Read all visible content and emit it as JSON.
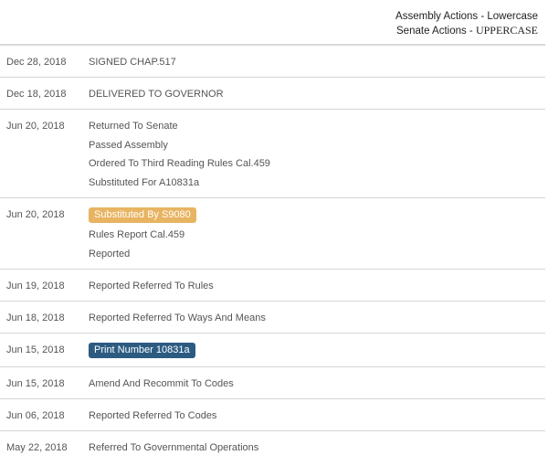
{
  "legend": {
    "assembly_label": "Assembly Actions - Lowercase",
    "senate_label": "Senate Actions - ",
    "senate_case": "UPPERCASE"
  },
  "actions": [
    {
      "date": "Dec 28, 2018",
      "items": [
        {
          "text": "SIGNED CHAP.517"
        }
      ]
    },
    {
      "date": "Dec 18, 2018",
      "items": [
        {
          "text": "DELIVERED TO GOVERNOR"
        }
      ]
    },
    {
      "date": "Jun 20, 2018",
      "items": [
        {
          "text": "Returned To Senate"
        },
        {
          "text": "Passed Assembly"
        },
        {
          "text": "Ordered To Third Reading Rules Cal.459"
        },
        {
          "text": "Substituted For A10831a"
        }
      ]
    },
    {
      "date": "Jun 20, 2018",
      "items": [
        {
          "text": "Substituted By S9080",
          "badge": "sub"
        },
        {
          "text": "Rules Report Cal.459"
        },
        {
          "text": "Reported"
        }
      ]
    },
    {
      "date": "Jun 19, 2018",
      "items": [
        {
          "text": "Reported Referred To Rules"
        }
      ]
    },
    {
      "date": "Jun 18, 2018",
      "items": [
        {
          "text": "Reported Referred To Ways And Means"
        }
      ]
    },
    {
      "date": "Jun 15, 2018",
      "items": [
        {
          "text": "Print Number 10831a",
          "badge": "print"
        }
      ]
    },
    {
      "date": "Jun 15, 2018",
      "items": [
        {
          "text": "Amend And Recommit To Codes"
        }
      ]
    },
    {
      "date": "Jun 06, 2018",
      "items": [
        {
          "text": "Reported Referred To Codes"
        }
      ]
    },
    {
      "date": "May 22, 2018",
      "items": [
        {
          "text": "Referred To Governmental Operations"
        }
      ]
    }
  ],
  "colors": {
    "substituted_badge": "#e8b462",
    "print_badge": "#2c5b82"
  }
}
